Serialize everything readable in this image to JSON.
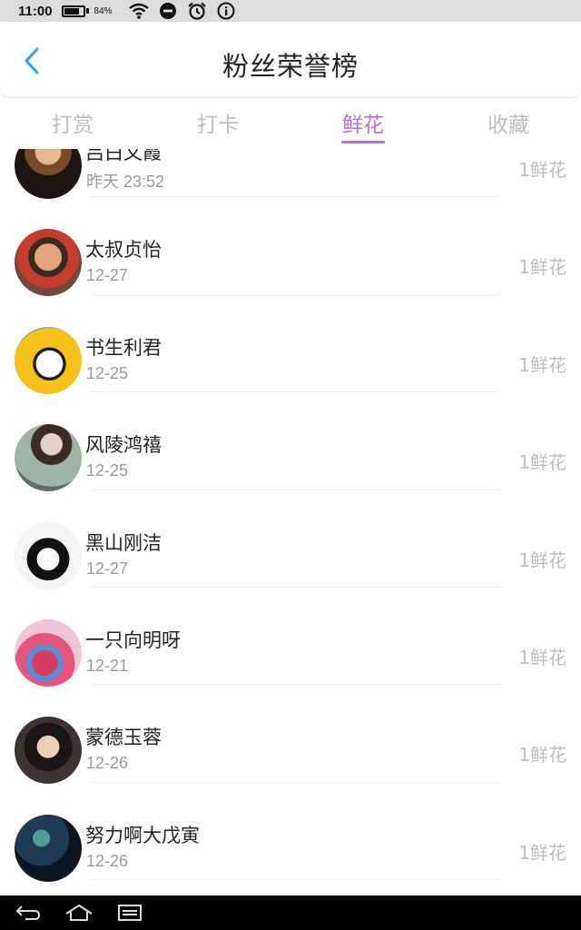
{
  "status_bar": {
    "time": "11:00",
    "battery_percent": "84%",
    "battery_level": 0.84,
    "icons": [
      "battery-icon",
      "wifi-icon",
      "do-not-disturb-icon",
      "alarm-icon",
      "info-icon"
    ]
  },
  "header": {
    "title": "粉丝荣誉榜",
    "back_icon": "chevron-left-icon"
  },
  "tabs": [
    {
      "label": "打赏",
      "active": false
    },
    {
      "label": "打卡",
      "active": false
    },
    {
      "label": "鲜花",
      "active": true
    },
    {
      "label": "收藏",
      "active": false
    }
  ],
  "colors": {
    "accent": "#b26fd6",
    "back_icon": "#2a9df4",
    "muted_text": "#9a9a9a",
    "count_text": "#bdbdbd"
  },
  "fans": [
    {
      "name": "吕白文霞",
      "date": "昨天 23:52",
      "count": "1鲜花"
    },
    {
      "name": "太叔贞怡",
      "date": "12-27",
      "count": "1鲜花"
    },
    {
      "name": "书生利君",
      "date": "12-25",
      "count": "1鲜花"
    },
    {
      "name": "风陵鸿禧",
      "date": "12-25",
      "count": "1鲜花"
    },
    {
      "name": "黑山刚洁",
      "date": "12-27",
      "count": "1鲜花"
    },
    {
      "name": "一只向明呀",
      "date": "12-21",
      "count": "1鲜花"
    },
    {
      "name": "蒙德玉蓉",
      "date": "12-26",
      "count": "1鲜花"
    },
    {
      "name": "努力啊大戊寅",
      "date": "12-26",
      "count": "1鲜花"
    }
  ],
  "nav_bar": {
    "icons": [
      "back-nav-icon",
      "home-nav-icon",
      "recents-nav-icon"
    ]
  }
}
